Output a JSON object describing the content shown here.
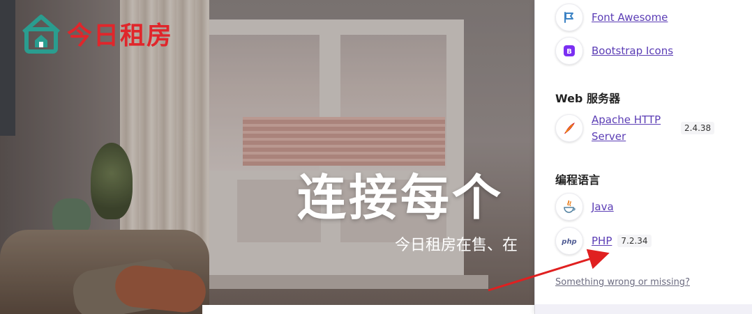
{
  "site": {
    "logo_text": "今日租房",
    "headline": "连接每个",
    "subline": "今日租房在售、在"
  },
  "panel": {
    "ui_libraries": [
      {
        "name": "Font Awesome",
        "icon": "font-awesome-flag-icon"
      },
      {
        "name": "Bootstrap Icons",
        "icon": "bootstrap-b-icon"
      }
    ],
    "web_servers_title": "Web 服务器",
    "web_servers": [
      {
        "name": "Apache HTTP Server",
        "version": "2.4.38",
        "icon": "apache-feather-icon"
      }
    ],
    "languages_title": "编程语言",
    "languages": [
      {
        "name": "Java",
        "icon": "java-cup-icon"
      },
      {
        "name": "PHP",
        "version": "7.2.34",
        "icon": "php-logo-icon"
      }
    ],
    "missing_link": "Something wrong or missing?"
  },
  "colors": {
    "logo_red": "#e0262b",
    "logo_teal": "#2a9d8f",
    "link_purple": "#5b3db5",
    "arrow_red": "#e02020"
  }
}
